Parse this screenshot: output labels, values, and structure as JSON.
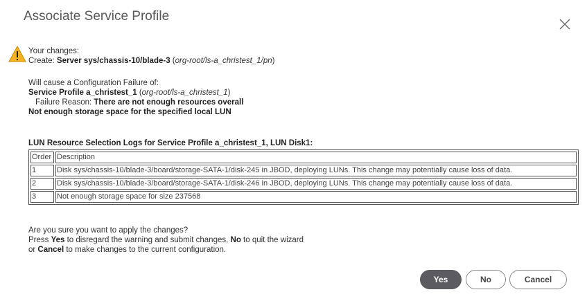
{
  "dialog": {
    "title": "Associate Service Profile",
    "close_icon": "close-icon"
  },
  "warning_icon": "warning-triangle-icon",
  "changes": {
    "intro": "Your changes:",
    "create_prefix": "Create: ",
    "create_target": "Server sys/chassis-10/blade-3",
    "create_path_open": " (",
    "create_path": "org-root/ls-a_christest_1/pn",
    "create_path_close": ")"
  },
  "failure": {
    "intro": "Will cause a Configuration Failure of:",
    "profile_label": "Service Profile a_christest_1",
    "profile_path_open": " (",
    "profile_path": "org-root/ls-a_christest_1",
    "profile_path_close": ")",
    "reason_label": "Failure Reason: ",
    "reason_text": "There are not enough resources overall",
    "detail": "Not enough storage space for the specified local LUN"
  },
  "log": {
    "title": "LUN Resource Selection Logs for Service Profile a_christest_1, LUN Disk1:",
    "headers": [
      "Order",
      "Description"
    ],
    "rows": [
      [
        "1",
        "Disk sys/chassis-10/blade-3/board/storage-SATA-1/disk-245 in JBOD, deploying LUNs. This change may potentially cause loss of data."
      ],
      [
        "2",
        "Disk sys/chassis-10/blade-3/board/storage-SATA-1/disk-246 in JBOD, deploying LUNs. This change may potentially cause loss of data."
      ],
      [
        "3",
        "Not enough storage space for size 237568"
      ]
    ]
  },
  "question": {
    "line1": "Are you sure you want to apply the changes?",
    "line2_a": "Press ",
    "line2_yes": "Yes",
    "line2_b": " to disregard the warning and submit changes, ",
    "line2_no": "No",
    "line2_c": " to quit the wizard",
    "line3_a": "or ",
    "line3_cancel": "Cancel",
    "line3_b": " to make changes to the current configuration."
  },
  "buttons": {
    "yes": "Yes",
    "no": "No",
    "cancel": "Cancel"
  }
}
